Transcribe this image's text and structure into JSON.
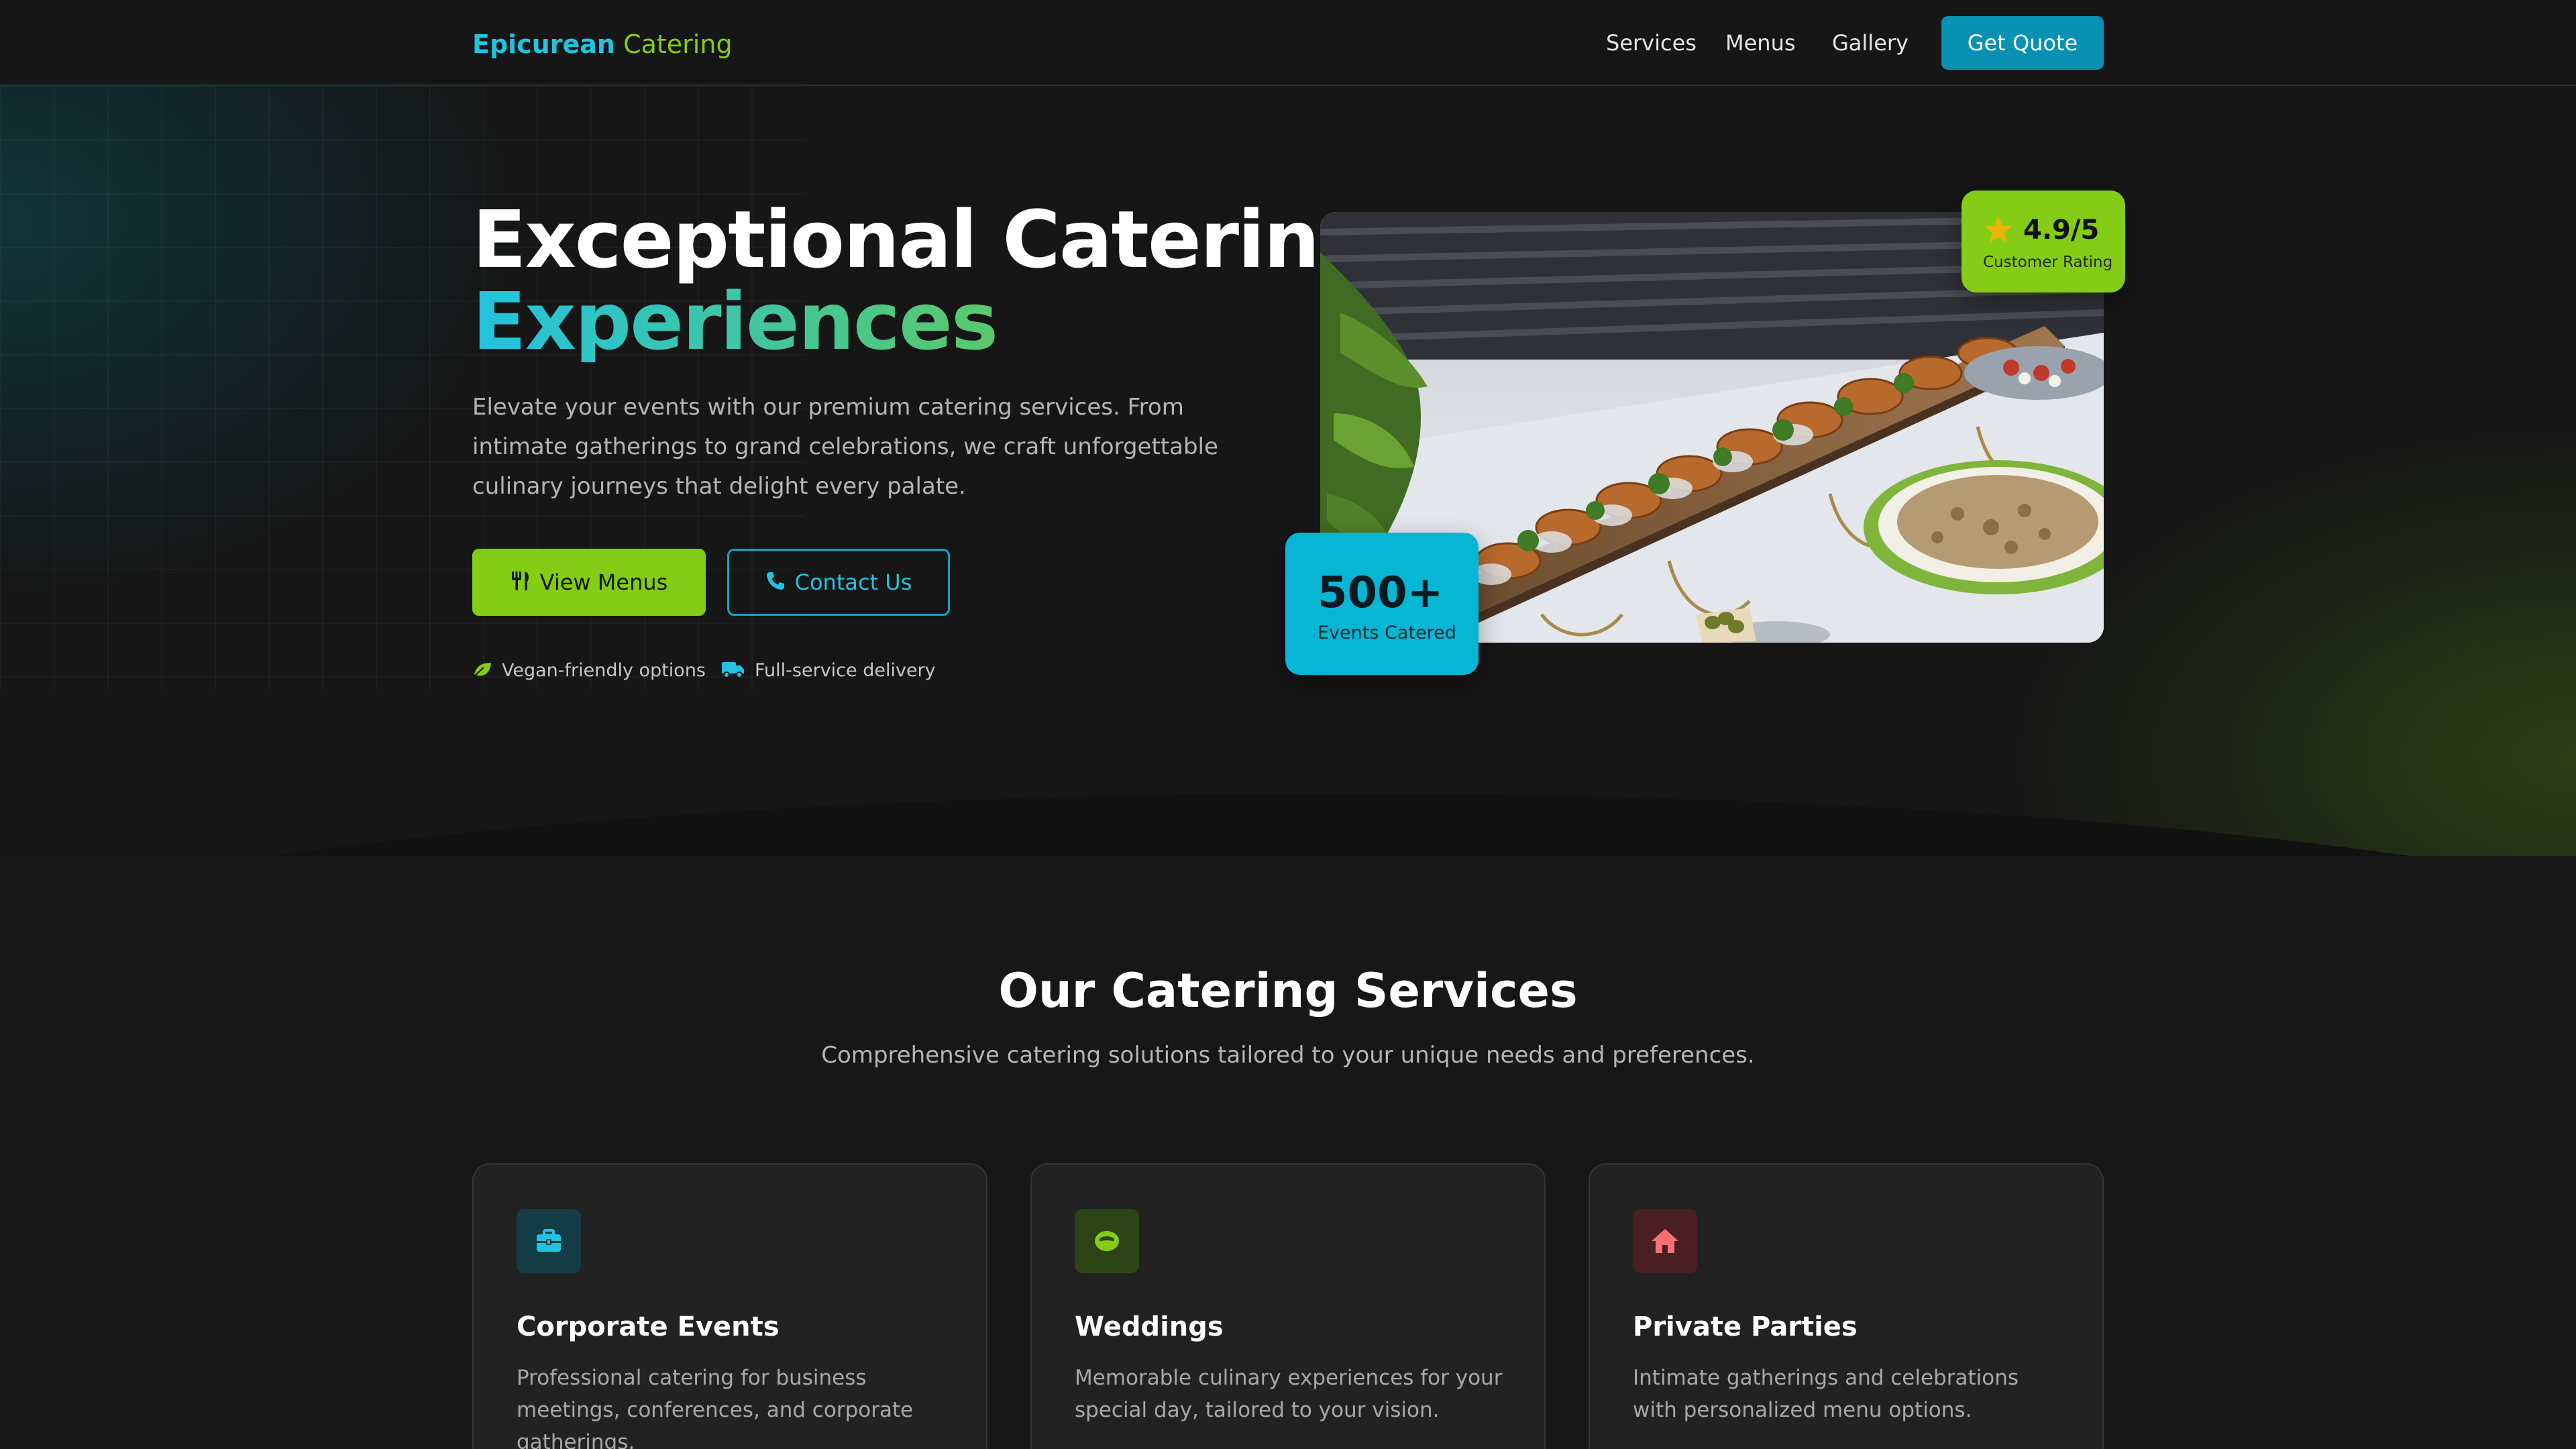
{
  "nav": {
    "brand_primary": "Epicurean",
    "brand_secondary": "Catering",
    "links": [
      "Services",
      "Menus",
      "Gallery"
    ],
    "cta": "Get Quote"
  },
  "hero": {
    "headline_line1": "Exceptional Catering",
    "headline_line2": "Experiences",
    "description": "Elevate your events with our premium catering services. From intimate gatherings to grand celebrations, we craft unforgettable culinary journeys that delight every palate.",
    "primary_button": "View Menus",
    "secondary_button": "Contact Us",
    "features": [
      "Vegan-friendly options",
      "Full-service delivery"
    ],
    "rating": {
      "value": "4.9/5",
      "label": "Customer Rating"
    },
    "events": {
      "value": "500+",
      "label": "Events Catered"
    }
  },
  "services": {
    "title": "Our Catering Services",
    "subtitle": "Comprehensive catering solutions tailored to your unique needs and preferences.",
    "cards": [
      {
        "title": "Corporate Events",
        "description": "Professional catering for business meetings, conferences, and corporate gatherings.",
        "icon": "briefcase-icon"
      },
      {
        "title": "Weddings",
        "description": "Memorable culinary experiences for your special day, tailored to your vision.",
        "icon": "ring-icon"
      },
      {
        "title": "Private Parties",
        "description": "Intimate gatherings and celebrations with personalized menu options.",
        "icon": "home-icon"
      }
    ]
  },
  "colors": {
    "cyan": "#22c3e0",
    "lime": "#84cc16",
    "background": "#171717",
    "quote_button": "#0891b2"
  }
}
